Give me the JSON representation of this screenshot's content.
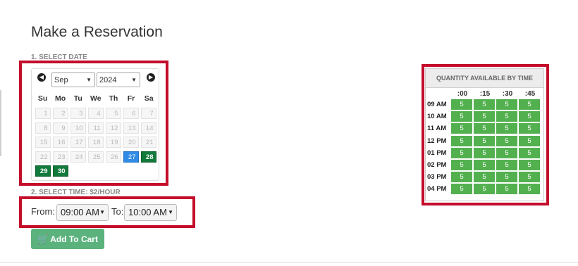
{
  "page_title": "Make a Reservation",
  "step1_label": "1. SELECT DATE",
  "step2_label": "2. SELECT TIME: $2/HOUR",
  "calendar": {
    "prev_icon": "arrow-left-icon",
    "next_icon": "arrow-right-icon",
    "month": "Sep",
    "year": "2024",
    "weekdays": [
      "Su",
      "Mo",
      "Tu",
      "We",
      "Th",
      "Fr",
      "Sa"
    ],
    "weeks": [
      [
        "1",
        "2",
        "3",
        "4",
        "5",
        "6",
        "7"
      ],
      [
        "8",
        "9",
        "10",
        "11",
        "12",
        "13",
        "14"
      ],
      [
        "15",
        "16",
        "17",
        "18",
        "19",
        "20",
        "21"
      ],
      [
        "22",
        "23",
        "24",
        "25",
        "26",
        "27",
        "28"
      ],
      [
        "29",
        "30",
        "",
        "",
        "",
        "",
        ""
      ]
    ],
    "selected_day": "27",
    "available_days": [
      "28",
      "29",
      "30"
    ],
    "colors": {
      "selected": "#2f8be6",
      "available": "#117a3a",
      "disabled": "#f6f6f6"
    }
  },
  "time": {
    "from_label": "From:",
    "from_value": "09:00 AM",
    "to_label": "To:",
    "to_value": "10:00 AM"
  },
  "add_to_cart": {
    "label": "Add To Cart",
    "icon": "cart-plus-icon",
    "color": "#5cb27d"
  },
  "quantity": {
    "title": "QUANTITY AVAILABLE BY TIME",
    "columns": [
      ":00",
      ":15",
      ":30",
      ":45"
    ],
    "rows": [
      {
        "time": "09 AM",
        "values": [
          "5",
          "5",
          "5",
          "5"
        ]
      },
      {
        "time": "10 AM",
        "values": [
          "5",
          "5",
          "5",
          "5"
        ]
      },
      {
        "time": "11 AM",
        "values": [
          "5",
          "5",
          "5",
          "5"
        ]
      },
      {
        "time": "12 PM",
        "values": [
          "5",
          "5",
          "5",
          "5"
        ]
      },
      {
        "time": "01 PM",
        "values": [
          "5",
          "5",
          "5",
          "5"
        ]
      },
      {
        "time": "02 PM",
        "values": [
          "5",
          "5",
          "5",
          "5"
        ]
      },
      {
        "time": "03 PM",
        "values": [
          "5",
          "5",
          "5",
          "5"
        ]
      },
      {
        "time": "04 PM",
        "values": [
          "5",
          "5",
          "5",
          "5"
        ]
      }
    ],
    "cell_color": "#53b04f"
  },
  "highlight_color": "#c40d2b"
}
